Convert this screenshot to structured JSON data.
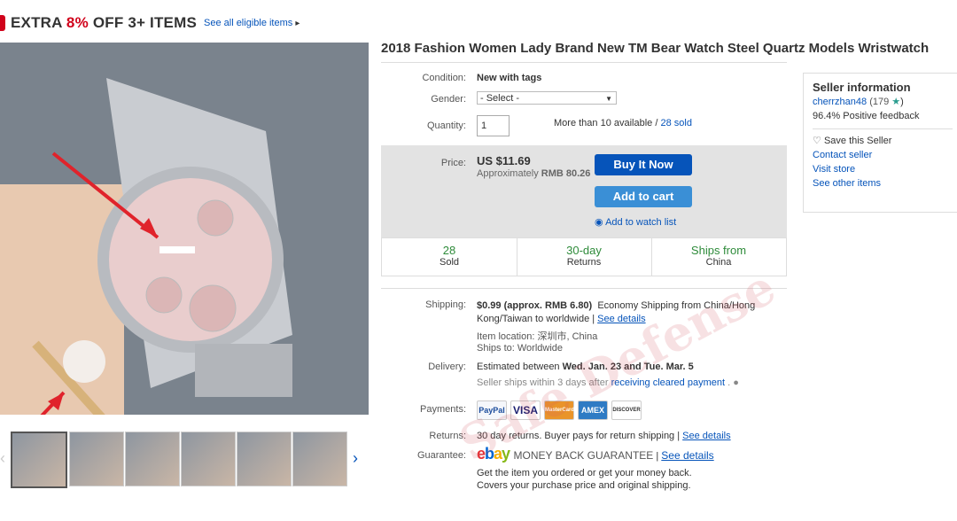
{
  "promo": {
    "prefix": "EXTRA ",
    "percent": "8%",
    "suffix": " OFF 3+ ITEMS",
    "link": "See all eligible items",
    "arrow": "▸"
  },
  "title": "2018 Fashion Women Lady Brand New TM Bear Watch Steel Quartz Models Wristwatch",
  "condition": {
    "label": "Condition:",
    "value": "New with tags"
  },
  "gender": {
    "label": "Gender:",
    "value": "- Select -"
  },
  "quantity": {
    "label": "Quantity:",
    "value": "1",
    "available": "More than 10 available / ",
    "sold_link": "28 sold"
  },
  "price": {
    "label": "Price:",
    "value": "US $11.69",
    "approx": "Approximately ",
    "approx_value": "RMB 80.26"
  },
  "buttons": {
    "buy": "Buy It Now",
    "cart": "Add to cart",
    "watch": "Add to watch list"
  },
  "stats": [
    {
      "value": "28",
      "label": "Sold"
    },
    {
      "value": "30-day",
      "label": "Returns"
    },
    {
      "value": "Ships from",
      "label": "China"
    }
  ],
  "seller": {
    "heading": "Seller information",
    "name": "cherrzhan48",
    "score": " (179 ",
    "score_close": ")",
    "feedback": "96.4% Positive feedback",
    "save": "Save this Seller",
    "contact": "Contact seller",
    "visit": "Visit store",
    "other": "See other items"
  },
  "shipping": {
    "label": "Shipping:",
    "cost": "$0.99 (approx. RMB 6.80)",
    "method": "Economy Shipping from China/Hong",
    "method2": "Kong/Taiwan to worldwide | ",
    "details": "See details",
    "location": "Item location: 深圳市, China",
    "ships_to": "Ships to: Worldwide"
  },
  "delivery": {
    "label": "Delivery:",
    "text": "Estimated between ",
    "dates": "Wed. Jan. 23 and Tue. Mar. 5",
    "note": "Seller ships within 3 days after ",
    "note_link": "receiving cleared payment",
    "note_end": " ."
  },
  "payments": {
    "label": "Payments:",
    "methods": [
      "PayPal",
      "VISA",
      "MasterCard",
      "AMEX",
      "DISCOVER"
    ]
  },
  "returns": {
    "label": "Returns:",
    "text": "30 day returns. Buyer pays for return shipping | ",
    "link": "See details"
  },
  "guarantee": {
    "label": "Guarantee:",
    "logo": "ebay",
    "mbg": "MONEY BACK GUARANTEE",
    "sep": " | ",
    "link": "See details",
    "line1": "Get the item you ordered or get your money back.",
    "line2": "Covers your purchase price and original shipping."
  },
  "watermark": "Safe Defense",
  "colors": {
    "link": "#0654ba",
    "buy": "#0654ba",
    "cart": "#3a8fd6",
    "accent_red": "#d0021b",
    "stat_green": "#2e8b3a"
  }
}
